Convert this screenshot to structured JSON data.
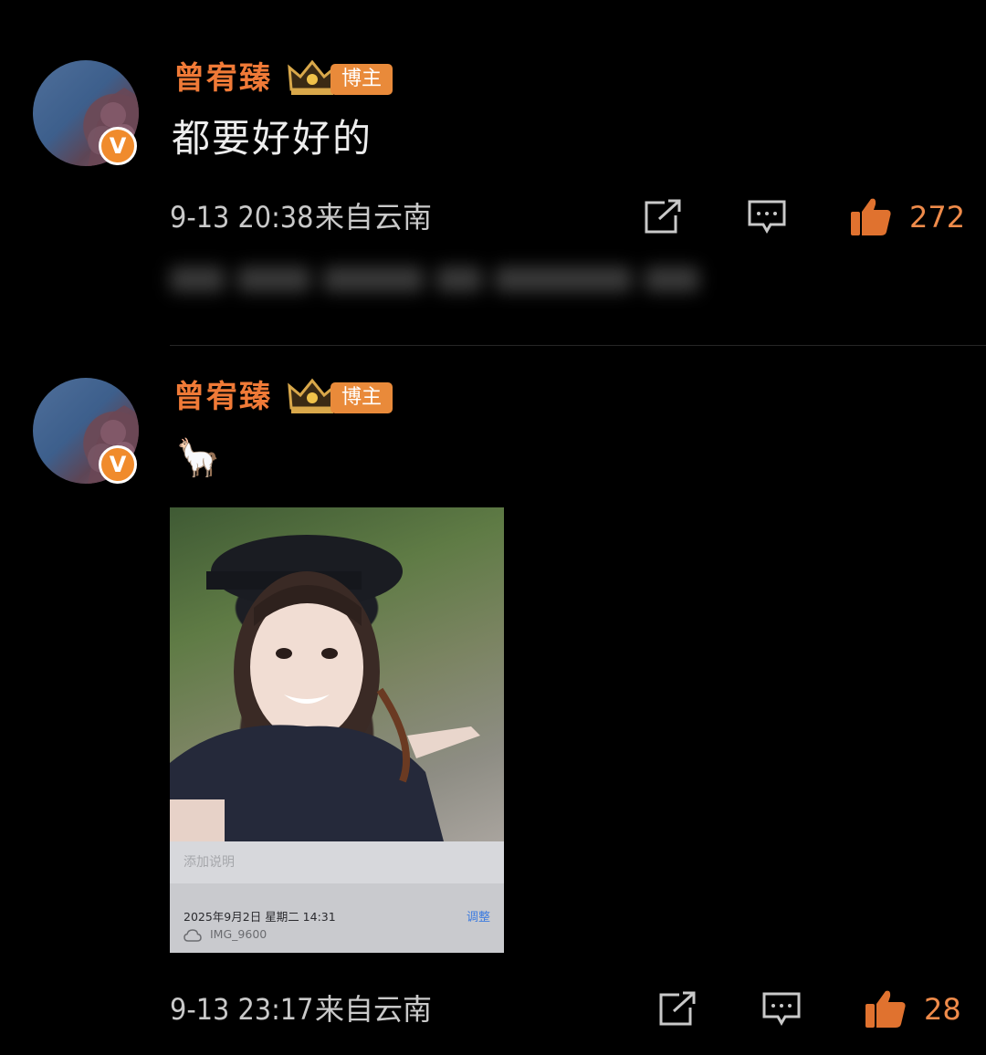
{
  "posts": [
    {
      "username": "曾宥臻",
      "tag": "博主",
      "verified_badge": "V",
      "text": "都要好好的",
      "time": "9-13 20:38",
      "location": "来自云南",
      "likes": "272"
    },
    {
      "username": "曾宥臻",
      "tag": "博主",
      "verified_badge": "V",
      "emoji": "🦙",
      "photo": {
        "caption_placeholder": "添加说明",
        "date": "2025年9月2日 星期二 14:31",
        "adjust_label": "调整",
        "filename": "IMG_9600"
      },
      "time": "9-13 23:17",
      "location": "来自云南",
      "likes": "28"
    }
  ],
  "colors": {
    "username": "#f07a37",
    "tag_bg": "#e98a3a",
    "like": "#ef8b4a",
    "background": "#000000"
  },
  "icons": [
    "share-icon",
    "comment-icon",
    "like-icon",
    "crown-icon",
    "verified-icon",
    "cloud-icon"
  ]
}
